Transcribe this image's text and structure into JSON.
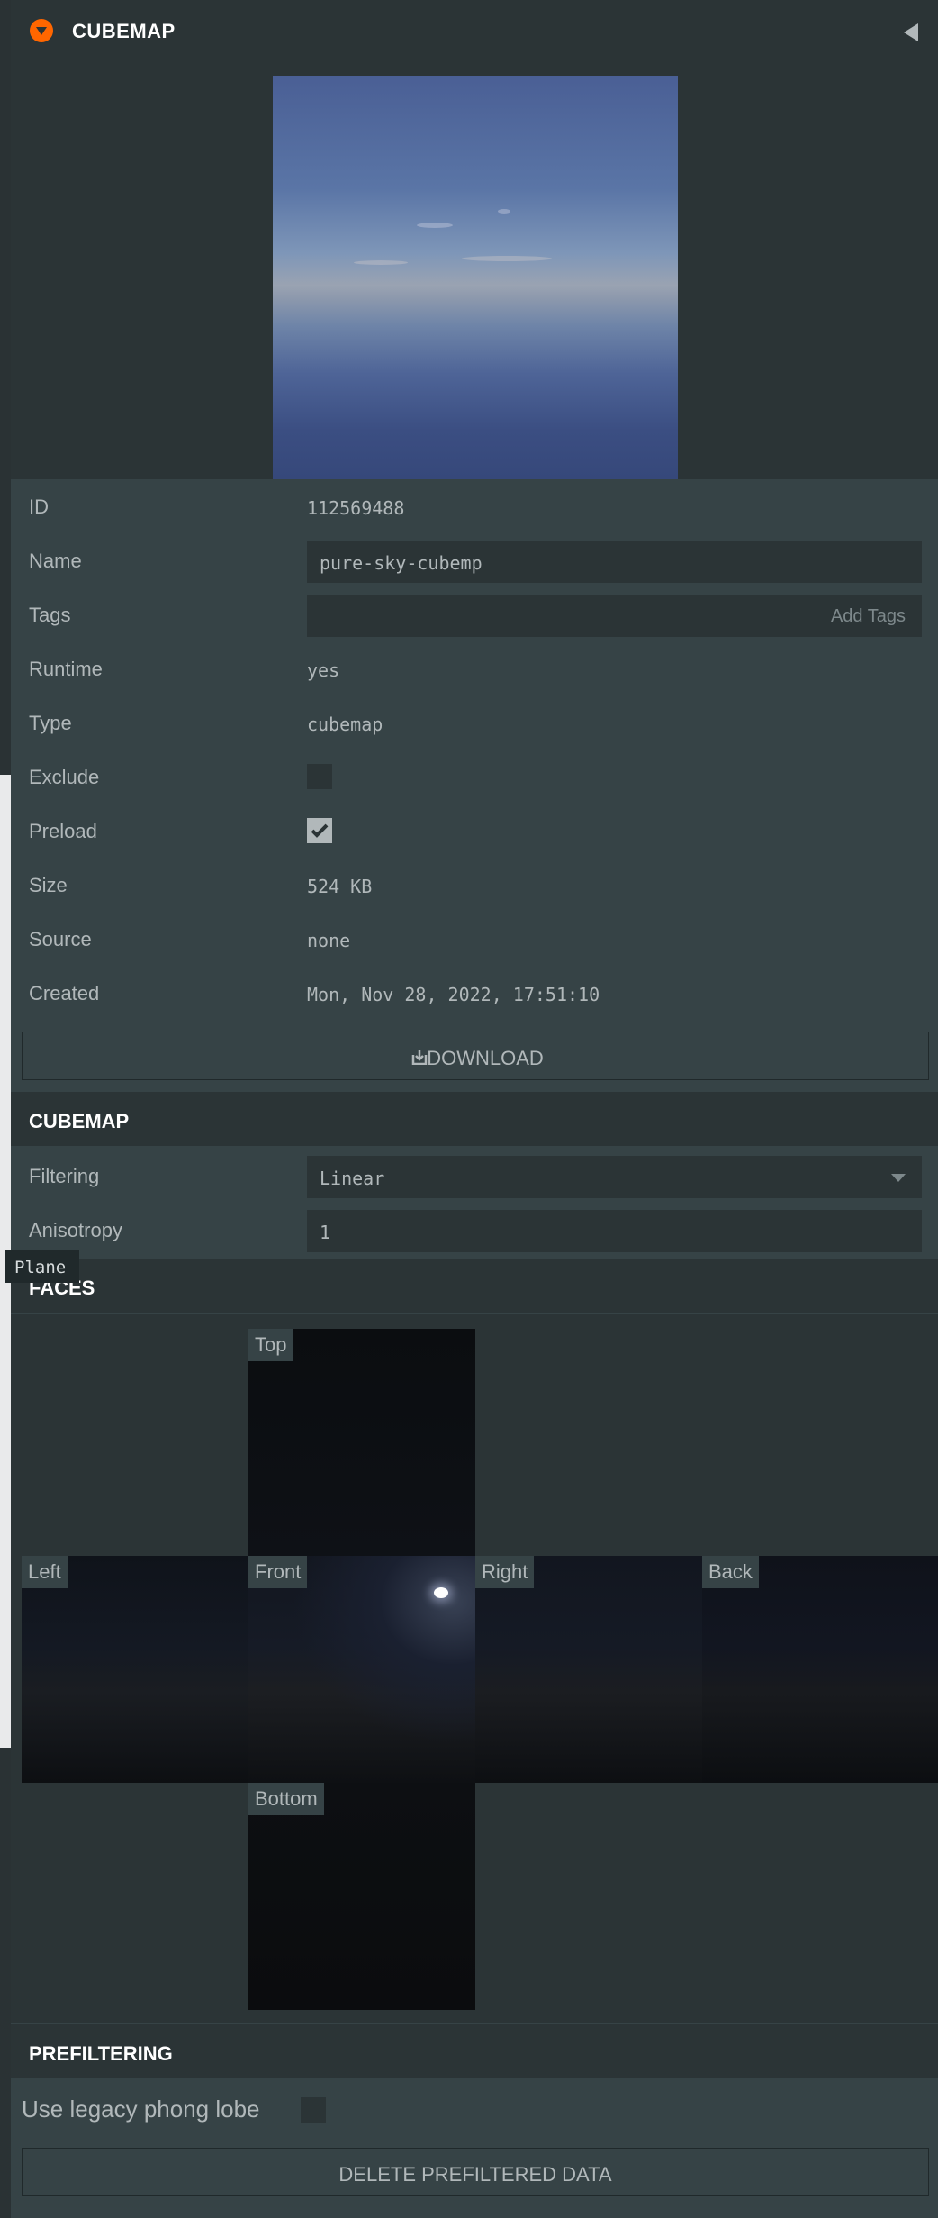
{
  "header": {
    "title": "CUBEMAP"
  },
  "properties": {
    "id": {
      "label": "ID",
      "value": "112569488"
    },
    "name": {
      "label": "Name",
      "value": "pure-sky-cubemp"
    },
    "tags": {
      "label": "Tags",
      "placeholder": "Add Tags"
    },
    "runtime": {
      "label": "Runtime",
      "value": "yes"
    },
    "type": {
      "label": "Type",
      "value": "cubemap"
    },
    "exclude": {
      "label": "Exclude",
      "checked": false
    },
    "preload": {
      "label": "Preload",
      "checked": true
    },
    "size": {
      "label": "Size",
      "value": "524 KB"
    },
    "source": {
      "label": "Source",
      "value": "none"
    },
    "created": {
      "label": "Created",
      "value": "Mon, Nov 28, 2022, 17:51:10"
    }
  },
  "download_button": {
    "label": "DOWNLOAD",
    "icon": "download-icon"
  },
  "cubemap_section": {
    "title": "CUBEMAP",
    "filtering": {
      "label": "Filtering",
      "value": "Linear"
    },
    "anisotropy": {
      "label": "Anisotropy",
      "value": "1"
    }
  },
  "tooltip": {
    "text": "Plane"
  },
  "faces_section": {
    "title": "FACES",
    "faces": {
      "top": "Top",
      "left": "Left",
      "front": "Front",
      "right": "Right",
      "back": "Back",
      "bottom": "Bottom"
    }
  },
  "prefiltering_section": {
    "title": "PREFILTERING",
    "legacy_phong": {
      "label": "Use legacy phong lobe",
      "checked": false
    },
    "delete_button": "DELETE PREFILTERED DATA"
  },
  "colors": {
    "accent": "#ff6600",
    "panel": "#364346",
    "panel_dark": "#2b3436",
    "text": "#b1b8ba"
  }
}
